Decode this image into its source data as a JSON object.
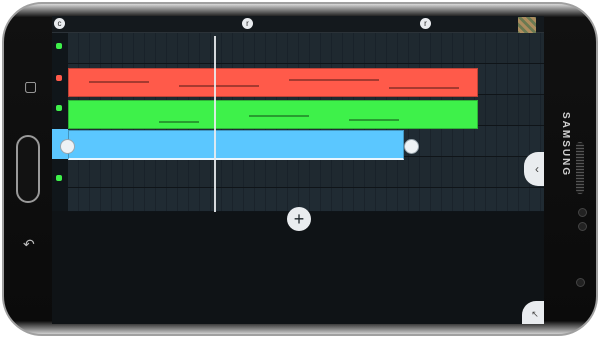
{
  "device": {
    "brand": "SAMSUNG"
  },
  "ruler": {
    "markers": [
      "c",
      "r",
      "r"
    ]
  },
  "tracks": [
    {
      "name": "",
      "color": "#ff5a4a"
    },
    {
      "name": "",
      "color": "#3ef14a"
    },
    {
      "name": "",
      "color": "#5bc7ff"
    }
  ],
  "buttons": {
    "add_symbol": "+",
    "expand_symbol": "‹",
    "resize_symbol": "↖"
  }
}
